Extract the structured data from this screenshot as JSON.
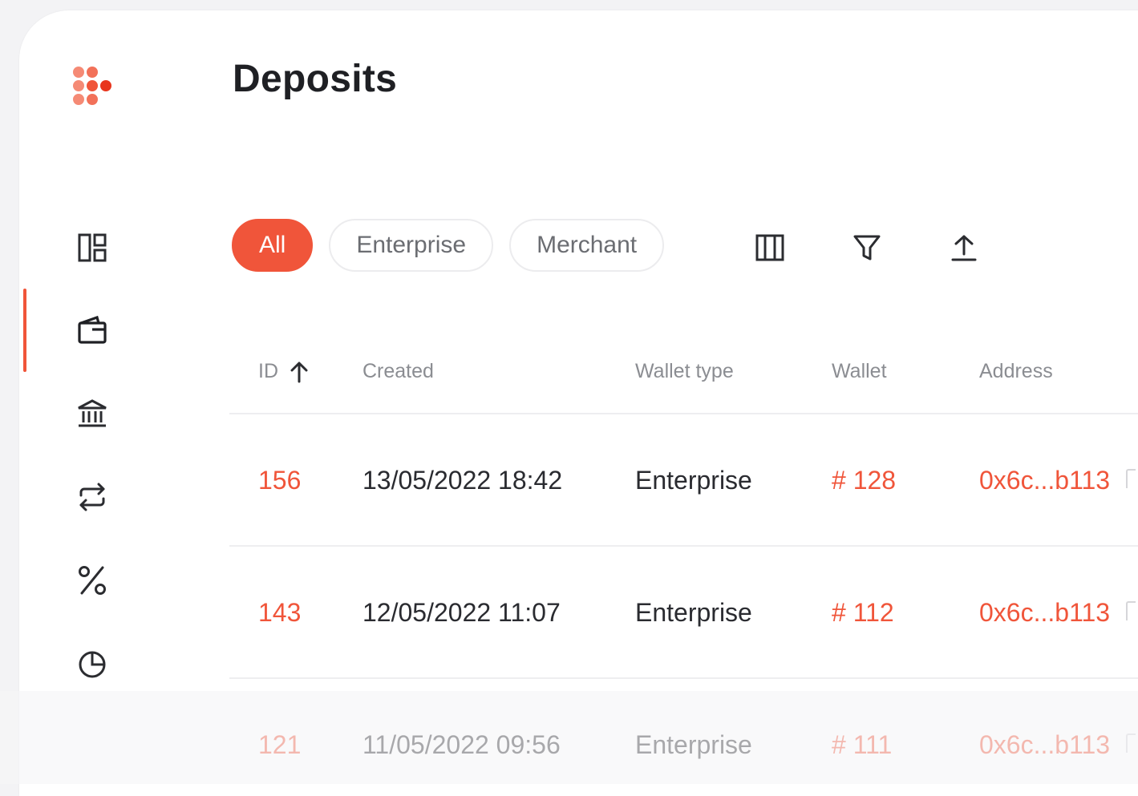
{
  "page": {
    "title": "Deposits"
  },
  "brand": {
    "logo_icon": "dots-logo-icon",
    "accent_color": "#f0553a"
  },
  "sidebar": {
    "items": [
      {
        "icon": "dashboard-icon",
        "active": false
      },
      {
        "icon": "wallet-icon",
        "active": true
      },
      {
        "icon": "bank-icon",
        "active": false
      },
      {
        "icon": "transfer-icon",
        "active": false
      },
      {
        "icon": "percent-icon",
        "active": false
      },
      {
        "icon": "pie-chart-icon",
        "active": false
      }
    ]
  },
  "filters": {
    "chips": [
      {
        "label": "All",
        "active": true
      },
      {
        "label": "Enterprise",
        "active": false
      },
      {
        "label": "Merchant",
        "active": false
      }
    ],
    "tools": [
      "columns-icon",
      "filter-icon",
      "export-icon"
    ]
  },
  "table": {
    "columns": [
      "ID",
      "Created",
      "Wallet type",
      "Wallet",
      "Address"
    ],
    "sort_icon": "arrow-up-icon",
    "rows": [
      {
        "id": "156",
        "created": "13/05/2022 18:42",
        "wallet_type": "Enterprise",
        "wallet": "# 128",
        "address": "0x6c...b113"
      },
      {
        "id": "143",
        "created": "12/05/2022 11:07",
        "wallet_type": "Enterprise",
        "wallet": "# 112",
        "address": "0x6c...b113"
      },
      {
        "id": "121",
        "created": "11/05/2022 09:56",
        "wallet_type": "Enterprise",
        "wallet": "# 111",
        "address": "0x6c...b113"
      }
    ]
  }
}
